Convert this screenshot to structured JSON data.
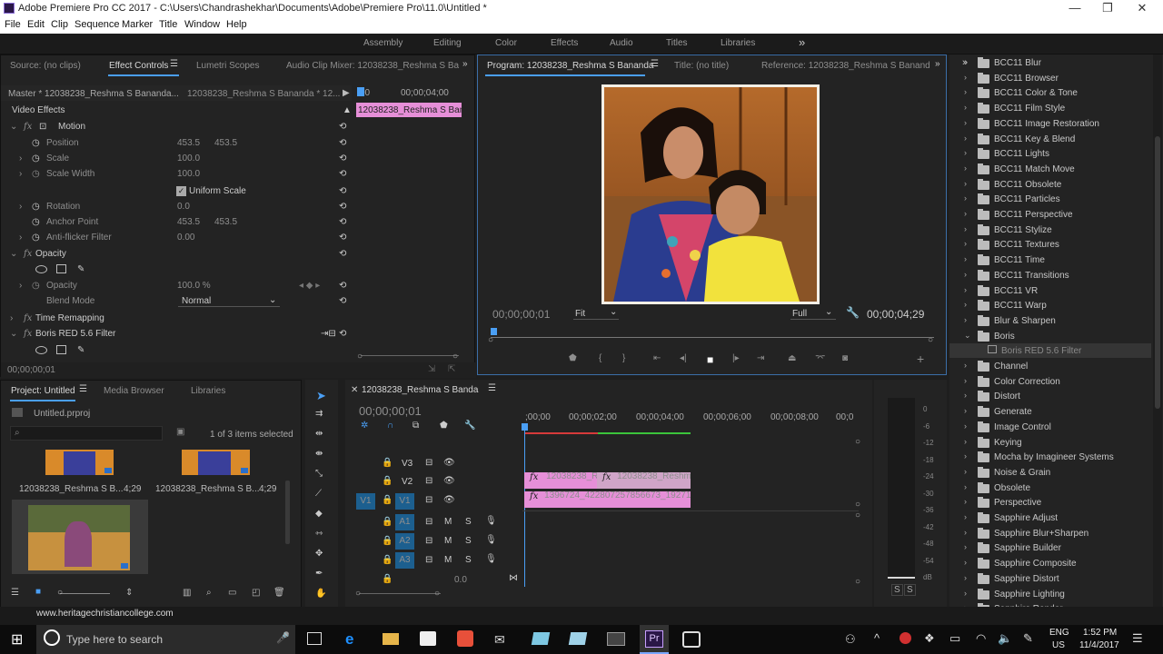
{
  "window": {
    "title": "Adobe Premiere Pro CC 2017 - C:\\Users\\Chandrashekhar\\Documents\\Adobe\\Premiere Pro\\11.0\\Untitled *",
    "min": "—",
    "max": "❐",
    "close": "✕"
  },
  "menu": [
    "File",
    "Edit",
    "Clip",
    "Sequence",
    "Marker",
    "Title",
    "Window",
    "Help"
  ],
  "workspaces": [
    "Assembly",
    "Editing",
    "Color",
    "Effects",
    "Audio",
    "Titles",
    "Libraries"
  ],
  "workspace_more": "»",
  "source_panel": {
    "tabs": [
      "Source: (no clips)",
      "Effect Controls",
      "Lumetri Scopes",
      "Audio Clip Mixer: 12038238_Reshma S Ba"
    ],
    "master": "Master * 12038238_Reshma S Bananda...",
    "clip": "12038238_Reshma S Bananda * 12...",
    "ruler": {
      "start": "00",
      "end": "00;00;04;00"
    },
    "clip_bar": "12038238_Reshma S Bana",
    "video_effects": "Video Effects",
    "motion": "Motion",
    "position": {
      "label": "Position",
      "x": "453.5",
      "y": "453.5"
    },
    "scale": {
      "label": "Scale",
      "value": "100.0"
    },
    "scale_width": {
      "label": "Scale Width",
      "value": "100.0"
    },
    "uniform_scale": "Uniform Scale",
    "rotation": {
      "label": "Rotation",
      "value": "0.0"
    },
    "anchor": {
      "label": "Anchor Point",
      "x": "453.5",
      "y": "453.5"
    },
    "antiflicker": {
      "label": "Anti-flicker Filter",
      "value": "0.00"
    },
    "opacity_group": "Opacity",
    "opacity": {
      "label": "Opacity",
      "value": "100.0 %"
    },
    "blend": {
      "label": "Blend Mode",
      "value": "Normal"
    },
    "time_remap": "Time Remapping",
    "boris": "Boris RED 5.6 Filter",
    "timecode": "00;00;00;01"
  },
  "program": {
    "tabs": [
      "Program: 12038238_Reshma S Bananda",
      "Title: (no title)",
      "Reference: 12038238_Reshma S Banand"
    ],
    "timecode": "00;00;00;01",
    "fit": "Fit",
    "quality": "Full",
    "duration": "00;00;04;29"
  },
  "effects_list": [
    "BCC11 Blur",
    "BCC11 Browser",
    "BCC11 Color & Tone",
    "BCC11 Film Style",
    "BCC11 Image Restoration",
    "BCC11 Key & Blend",
    "BCC11 Lights",
    "BCC11 Match Move",
    "BCC11 Obsolete",
    "BCC11 Particles",
    "BCC11 Perspective",
    "BCC11 Stylize",
    "BCC11 Textures",
    "BCC11 Time",
    "BCC11 Transitions",
    "BCC11 VR",
    "BCC11 Warp",
    "Blur & Sharpen",
    "Boris",
    "Boris RED 5.6 Filter",
    "Channel",
    "Color Correction",
    "Distort",
    "Generate",
    "Image Control",
    "Keying",
    "Mocha by Imagineer Systems",
    "Noise & Grain",
    "Obsolete",
    "Perspective",
    "Sapphire Adjust",
    "Sapphire Blur+Sharpen",
    "Sapphire Builder",
    "Sapphire Composite",
    "Sapphire Distort",
    "Sapphire Lighting",
    "Sapphire Render"
  ],
  "project": {
    "tabs": [
      "Project: Untitled",
      "Media Browser",
      "Libraries"
    ],
    "file": "Untitled.prproj",
    "count": "1 of 3 items selected",
    "items": [
      {
        "name": "12038238_Reshma S B...",
        "dur": "4;29"
      },
      {
        "name": "12038238_Reshma S B...",
        "dur": "4;29"
      }
    ]
  },
  "timeline": {
    "tab": "12038238_Reshma S Banda",
    "timecode": "00;00;00;01",
    "ruler": [
      ";00;00",
      "00;00;02;00",
      "00;00;04;00",
      "00;00;06;00",
      "00;00;08;00",
      "00;0"
    ],
    "tracks_v": [
      "V3",
      "V2",
      "V1"
    ],
    "tracks_a": [
      "A1",
      "A2",
      "A3"
    ],
    "v1_src": "V1",
    "clips": {
      "v2a": "12038238_Re",
      "v2b": "12038238_Reshm",
      "v1": "1396724_422807257856673_192710"
    },
    "master_vol": "0.0",
    "meter_db": [
      "0",
      "-6",
      "-12",
      "-18",
      "-24",
      "-30",
      "-36",
      "-42",
      "-48",
      "-54",
      "dB"
    ],
    "meter_solo": [
      "S",
      "S"
    ]
  },
  "watermark": "www.heritagechristiancollege.com",
  "taskbar": {
    "search": "Type here to search",
    "lang": "ENG",
    "region": "US",
    "time": "1:52 PM",
    "date": "11/4/2017"
  },
  "colors": {
    "accent": "#4a9ff5",
    "clip_pink": "#e68fd8",
    "track_blue": "#1c5f8f"
  }
}
